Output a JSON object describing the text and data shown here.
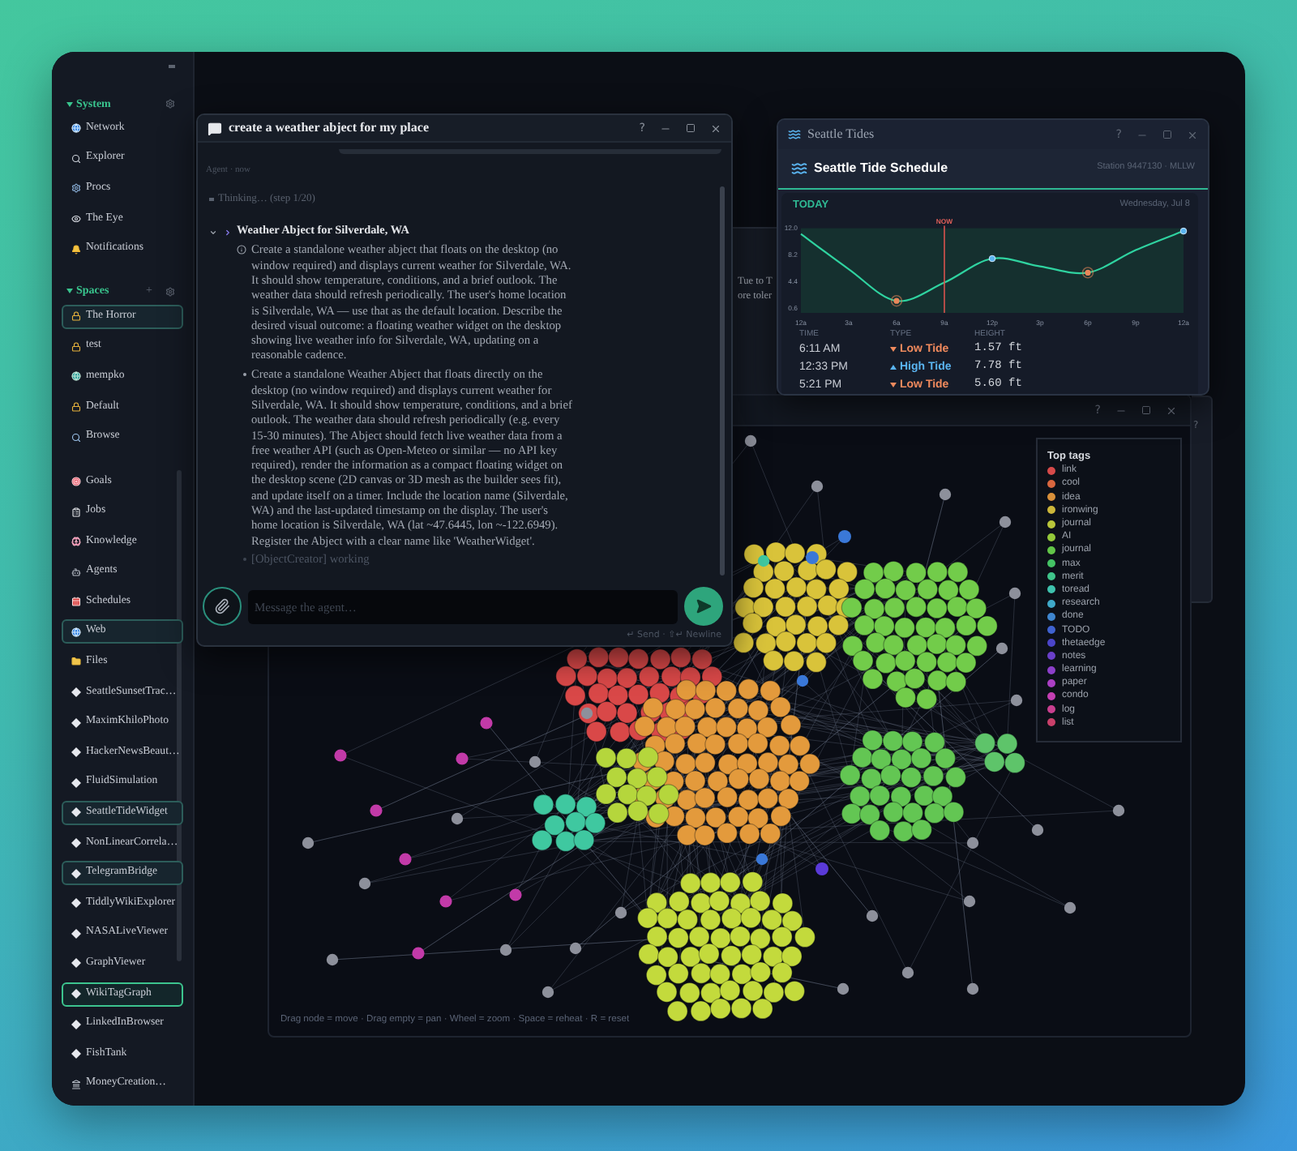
{
  "sidebar": {
    "sections": [
      {
        "title": "System",
        "expanded": true,
        "items": [
          {
            "label": "Network",
            "selected": false
          },
          {
            "label": "Explorer",
            "selected": false
          },
          {
            "label": "Procs",
            "selected": false
          },
          {
            "label": "The Eye",
            "selected": false
          },
          {
            "label": "Notifications",
            "selected": false
          }
        ]
      },
      {
        "title": "Spaces",
        "expanded": true,
        "add": "+",
        "items": [
          {
            "label": "The Horror",
            "selected": true
          },
          {
            "label": "test",
            "selected": false
          },
          {
            "label": "mempko",
            "selected": false
          },
          {
            "label": "Default",
            "selected": false
          },
          {
            "label": "Browse",
            "selected": false
          }
        ]
      }
    ],
    "apps": [
      {
        "label": "Goals",
        "selected": false,
        "focused": false
      },
      {
        "label": "Jobs",
        "selected": false,
        "focused": false
      },
      {
        "label": "Knowledge",
        "selected": false,
        "focused": false
      },
      {
        "label": "Agents",
        "selected": false,
        "focused": false
      },
      {
        "label": "Schedules",
        "selected": false,
        "focused": false
      },
      {
        "label": "Web",
        "selected": true,
        "focused": false
      },
      {
        "label": "Files",
        "selected": false,
        "focused": false
      },
      {
        "label": "SeattleSunsetTrac…",
        "selected": false,
        "focused": false
      },
      {
        "label": "MaximKhiloPhoto",
        "selected": false,
        "focused": false
      },
      {
        "label": "HackerNewsBeaut…",
        "selected": false,
        "focused": false
      },
      {
        "label": "FluidSimulation",
        "selected": false,
        "focused": false
      },
      {
        "label": "SeattleTideWidget",
        "selected": true,
        "focused": false
      },
      {
        "label": "NonLinearCorrela…",
        "selected": false,
        "focused": false
      },
      {
        "label": "TelegramBridge",
        "selected": true,
        "focused": false
      },
      {
        "label": "TiddlyWikiExplorer",
        "selected": false,
        "focused": false
      },
      {
        "label": "NASALiveViewer",
        "selected": false,
        "focused": false
      },
      {
        "label": "GraphViewer",
        "selected": false,
        "focused": false
      },
      {
        "label": "WikiTagGraph",
        "selected": true,
        "focused": true
      },
      {
        "label": "LinkedInBrowser",
        "selected": false,
        "focused": false
      },
      {
        "label": "FishTank",
        "selected": false,
        "focused": false
      },
      {
        "label": "MoneyCreation…",
        "selected": false,
        "focused": false
      }
    ]
  },
  "chat_window": {
    "title": "create a weather abject for my place",
    "help": "?",
    "meta": "Agent · now",
    "thinking": "Thinking… (step 1/20)",
    "task": {
      "title": "Weather Abject for Silverdale, WA",
      "expanded": true,
      "description": "Create a standalone weather abject that floats on the desktop (no window required) and displays current weather for Silverdale, WA. It should show temperature, conditions, and a brief outlook. The weather data should refresh periodically. The user's home location is Silverdale, WA — use that as the default location. Describe the desired visual outcome: a floating weather widget on the desktop showing live weather info for Silverdale, WA, updating on a reasonable cadence.",
      "steps": [
        {
          "kind": "step",
          "text": "Create a standalone Weather Abject that floats directly on the desktop (no window required) and displays current weather for Silverdale, WA. It should show temperature, conditions, and a brief outlook. The weather data should refresh periodically (e.g. every 15-30 minutes). The Abject should fetch live weather data from a free weather API (such as Open-Meteo or similar — no API key required), render the information as a compact floating widget on the desktop scene (2D canvas or 3D mesh as the builder sees fit), and update itself on a timer. Include the location name (Silverdale, WA) and the last-updated timestamp on the display. The user's home location is Silverdale, WA (lat ~47.6445, lon ~-122.6949). Register the Abject with a clear name like 'WeatherWidget'."
        },
        {
          "kind": "status",
          "text": "[ObjectCreator] working"
        }
      ]
    },
    "input": {
      "placeholder": "Message the agent…"
    },
    "hint": "↵ Send · ⇧↵ Newline"
  },
  "notes_window": {
    "lines": [
      "Tue to T",
      "ore toler"
    ]
  },
  "tides_window": {
    "title": "Seattle Tides",
    "help": "?",
    "heading": "Seattle Tide Schedule",
    "station": "Station 9447130 · MLLW",
    "day_label": "TODAY",
    "date": "Wednesday, Jul 8",
    "chart_data": {
      "type": "line",
      "categories": [
        "12a",
        "3a",
        "6a",
        "9a",
        "12p",
        "3p",
        "6p",
        "9p",
        "12a"
      ],
      "series": [
        {
          "color": "#2fd3a0",
          "values": [
            11.2,
            6.2,
            1.7,
            4.3,
            7.7,
            6.6,
            5.7,
            8.9,
            11.6
          ]
        }
      ],
      "ylim": [
        0,
        12
      ],
      "yticks": [
        {
          "value": 12,
          "label": "12.0"
        },
        {
          "value": 8.2,
          "label": "8.2"
        },
        {
          "value": 4.4,
          "label": "4.4"
        },
        {
          "value": 0.6,
          "label": "0.6"
        }
      ],
      "annotations": [
        {
          "x": "9a",
          "text": "NOW"
        }
      ]
    },
    "table": {
      "columns": [
        "TIME",
        "TYPE",
        "HEIGHT"
      ],
      "rows": [
        {
          "time": "6:11 AM",
          "kind": "low",
          "type": "Low Tide",
          "height": "1.57 ft"
        },
        {
          "time": "12:33 PM",
          "kind": "high",
          "type": "High Tide",
          "height": "7.78 ft"
        },
        {
          "time": "5:21 PM",
          "kind": "low",
          "type": "Low Tide",
          "height": "5.60 ft"
        }
      ]
    }
  },
  "graph_window": {
    "help": "?",
    "legend": {
      "title": "Top tags",
      "tags": [
        {
          "label": "link",
          "color": "#d64a4a"
        },
        {
          "label": "cool",
          "color": "#d9673f"
        },
        {
          "label": "idea",
          "color": "#d9903a"
        },
        {
          "label": "ironwing",
          "color": "#cdb73a"
        },
        {
          "label": "journal",
          "color": "#b9c63a"
        },
        {
          "label": "AI",
          "color": "#94c93a"
        },
        {
          "label": "journal",
          "color": "#62c548"
        },
        {
          "label": "max",
          "color": "#44c365"
        },
        {
          "label": "merit",
          "color": "#3fc48a"
        },
        {
          "label": "toread",
          "color": "#3ec2ae"
        },
        {
          "label": "research",
          "color": "#3fa9c9"
        },
        {
          "label": "done",
          "color": "#3f86cf"
        },
        {
          "label": "TODO",
          "color": "#3f62cf"
        },
        {
          "label": "thetaedge",
          "color": "#4b45c9"
        },
        {
          "label": "notes",
          "color": "#6a3fc9"
        },
        {
          "label": "learning",
          "color": "#8c3fc9"
        },
        {
          "label": "paper",
          "color": "#ab3fc4"
        },
        {
          "label": "condo",
          "color": "#c43fb3"
        },
        {
          "label": "log",
          "color": "#c93f8f"
        },
        {
          "label": "list",
          "color": "#c9406a"
        }
      ]
    },
    "hint": "Drag node = move · Drag empty = pan · Wheel = zoom · Space = reheat · R = reset"
  },
  "side_window": {
    "help": "?"
  }
}
